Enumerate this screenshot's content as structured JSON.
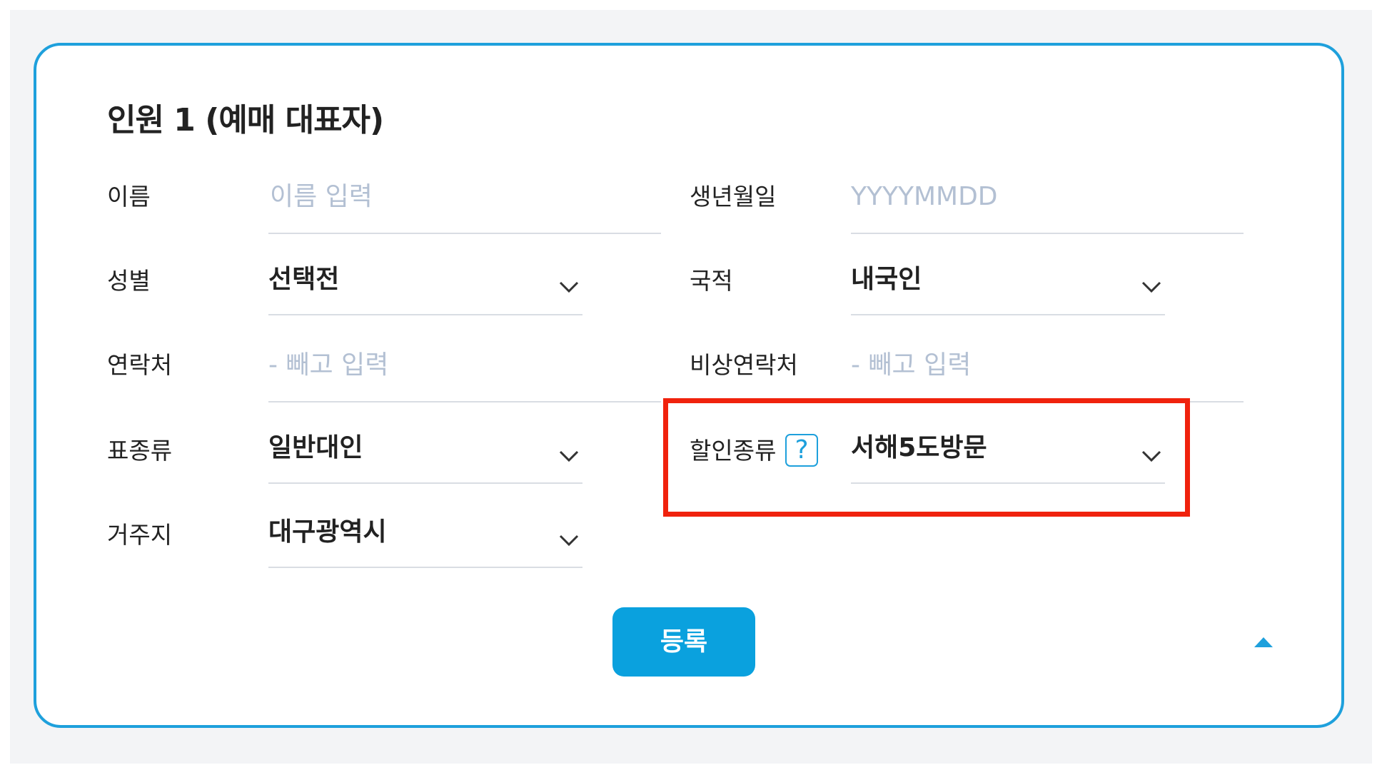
{
  "section": {
    "title": "인원 1 (예매 대표자)"
  },
  "fields": {
    "name": {
      "label": "이름",
      "placeholder": "이름 입력"
    },
    "birthdate": {
      "label": "생년월일",
      "placeholder": "YYYYMMDD"
    },
    "gender": {
      "label": "성별",
      "value": "선택전"
    },
    "nationality": {
      "label": "국적",
      "value": "내국인"
    },
    "contact": {
      "label": "연락처",
      "placeholder": "- 빼고 입력"
    },
    "emergency_contact": {
      "label": "비상연락처",
      "placeholder": "- 빼고 입력"
    },
    "ticket_type": {
      "label": "표종류",
      "value": "일반대인"
    },
    "discount_type": {
      "label": "할인종류",
      "help_icon": "?",
      "value": "서해5도방문"
    },
    "residence": {
      "label": "거주지",
      "value": "대구광역시"
    }
  },
  "buttons": {
    "register": "등록"
  },
  "icons": {
    "dropdown": "chevron-down-icon",
    "collapse": "caret-up-icon",
    "help": "question-icon"
  },
  "colors": {
    "accent": "#1ea0dc",
    "button": "#0aa1de",
    "placeholder": "#b3c0d3",
    "highlight": "#f0220d"
  }
}
